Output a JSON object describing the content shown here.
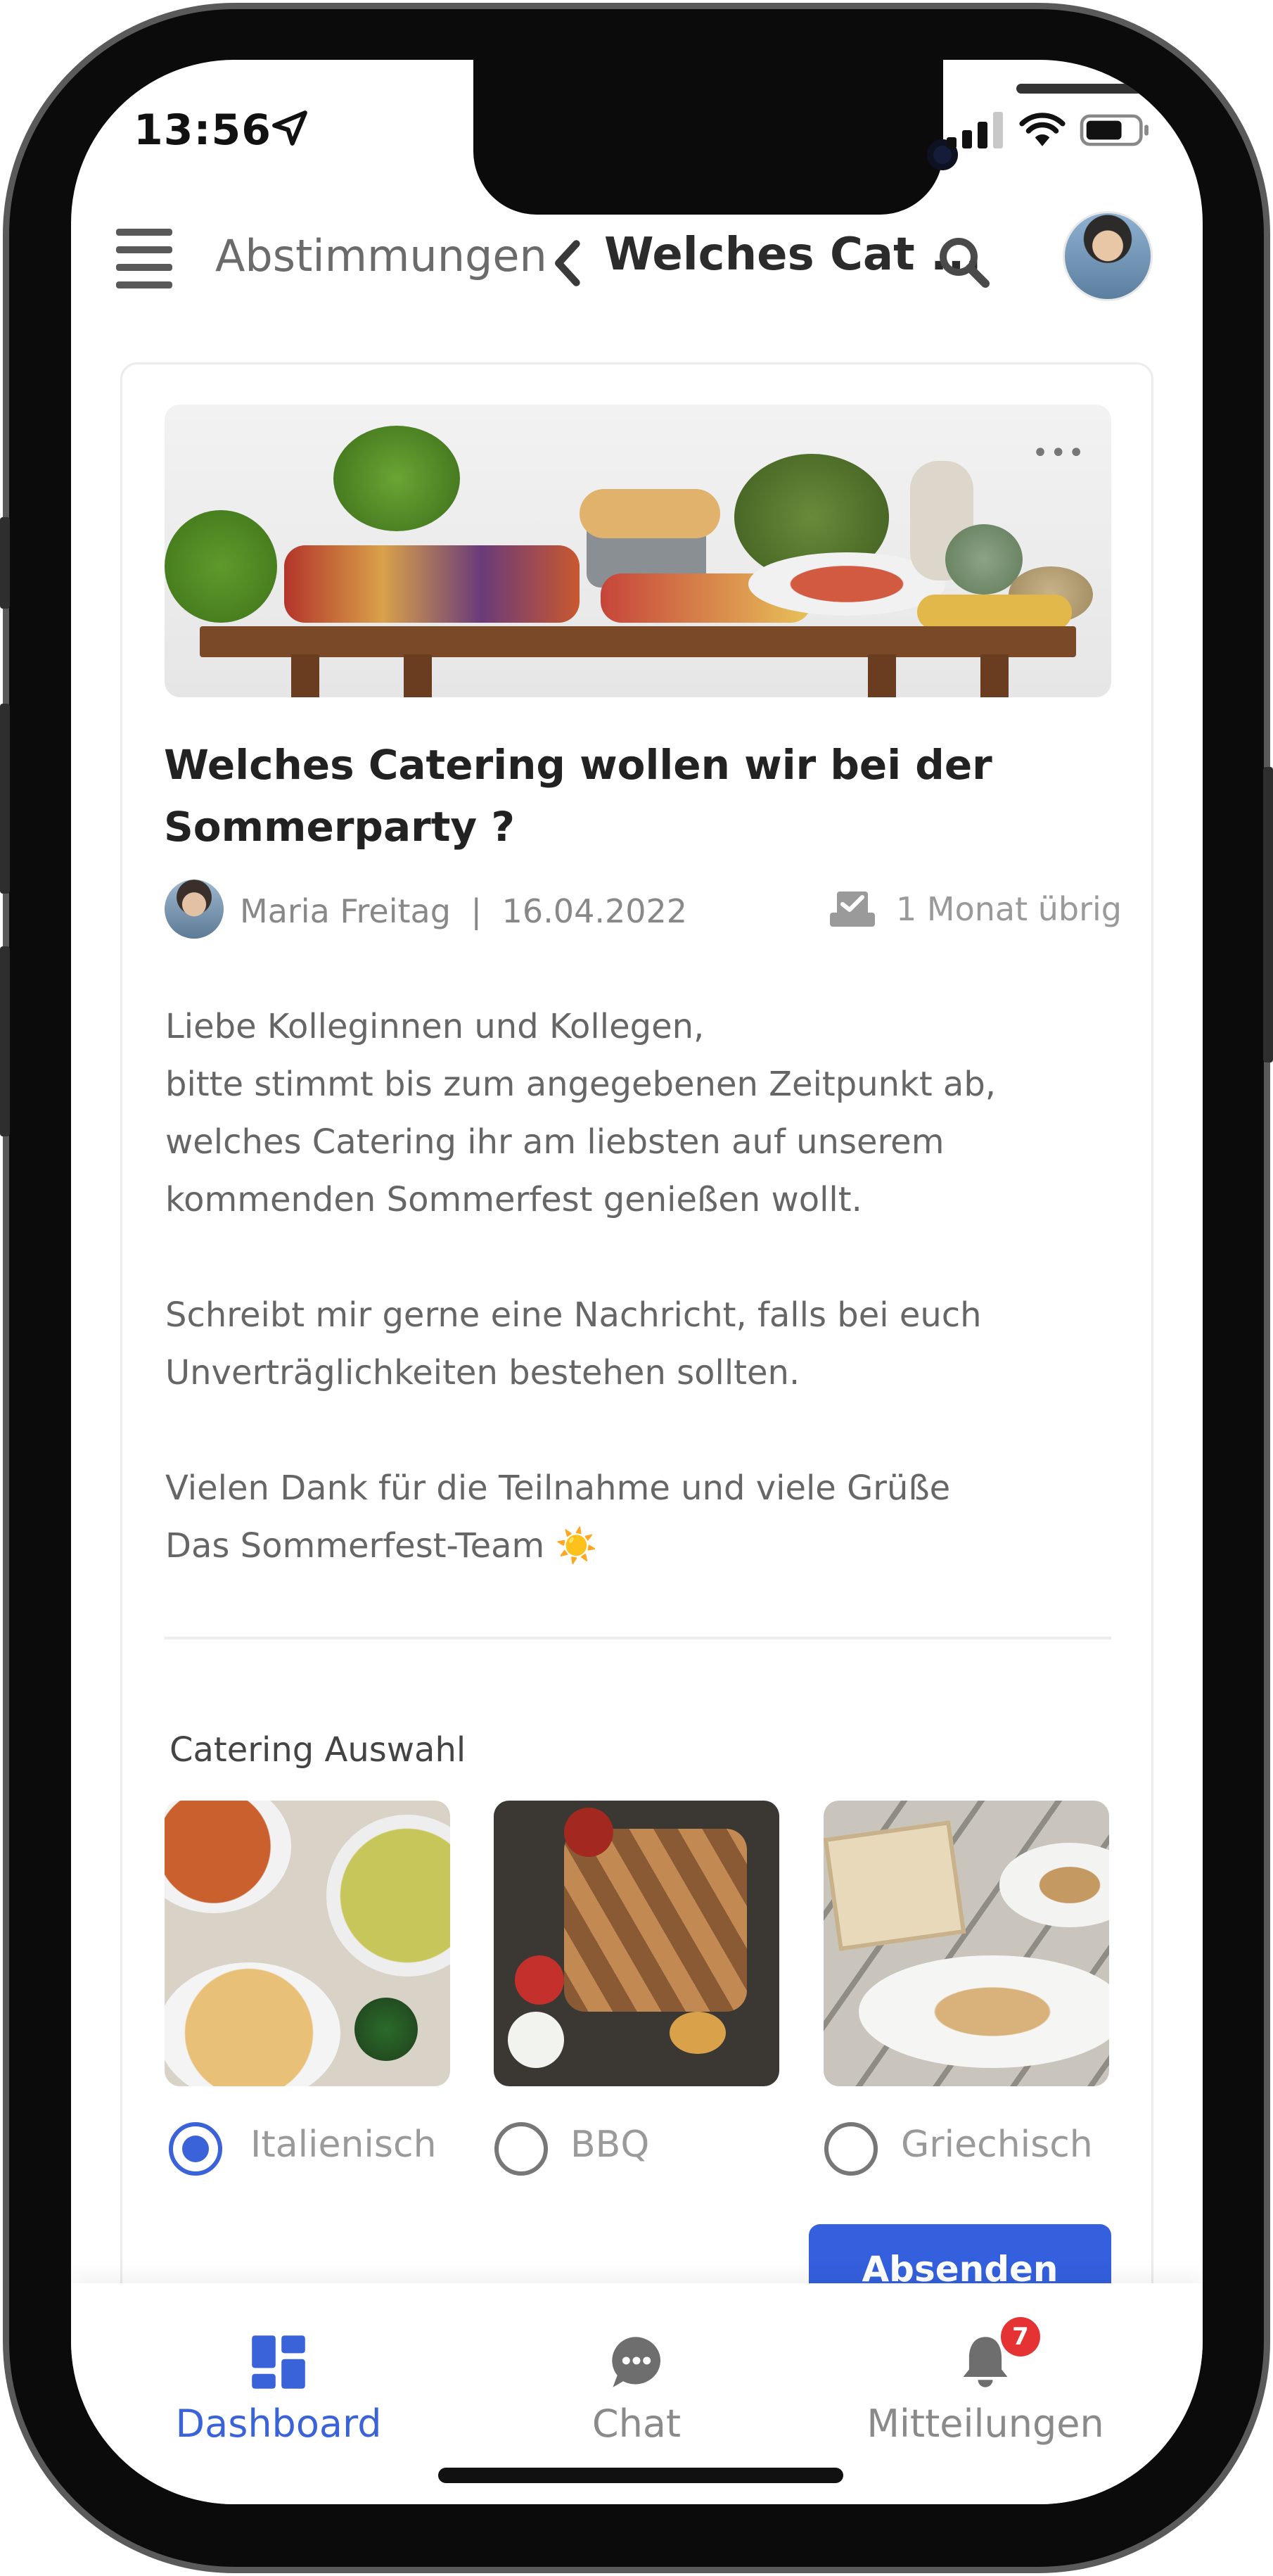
{
  "status_bar": {
    "time": "13:56"
  },
  "header": {
    "breadcrumb": "Abstimmungen",
    "title": "Welches Cat ..."
  },
  "poll": {
    "question": "Welches Catering wollen wir bei der Sommerparty ?",
    "author": "Maria Freitag",
    "date": "16.04.2022",
    "meta_separator": "|",
    "remaining": "1 Monat übrig",
    "description": "Liebe Kolleginnen und Kollegen,\nbitte stimmt bis zum angegebenen Zeitpunkt ab,\nwelches Catering ihr am liebsten auf unserem\nkommenden Sommerfest genießen wollt.\n\nSchreibt mir gerne eine Nachricht, falls bei euch\nUnverträglichkeiten bestehen sollten.\n\nVielen Dank für die Teilnahme und viele Grüße\nDas Sommerfest-Team ☀️",
    "section_title": "Catering Auswahl",
    "options": [
      {
        "label": "Italienisch",
        "selected": true
      },
      {
        "label": "BBQ",
        "selected": false
      },
      {
        "label": "Griechisch",
        "selected": false
      }
    ],
    "submit_label": "Absenden"
  },
  "tabbar": {
    "tabs": [
      {
        "label": "Dashboard",
        "icon": "dashboard-icon",
        "active": true
      },
      {
        "label": "Chat",
        "icon": "chat-icon",
        "active": false
      },
      {
        "label": "Mitteilungen",
        "icon": "bell-icon",
        "active": false,
        "badge": "7"
      }
    ]
  },
  "colors": {
    "accent": "#3b63d9",
    "button": "#3460de",
    "badge": "#e53333"
  }
}
